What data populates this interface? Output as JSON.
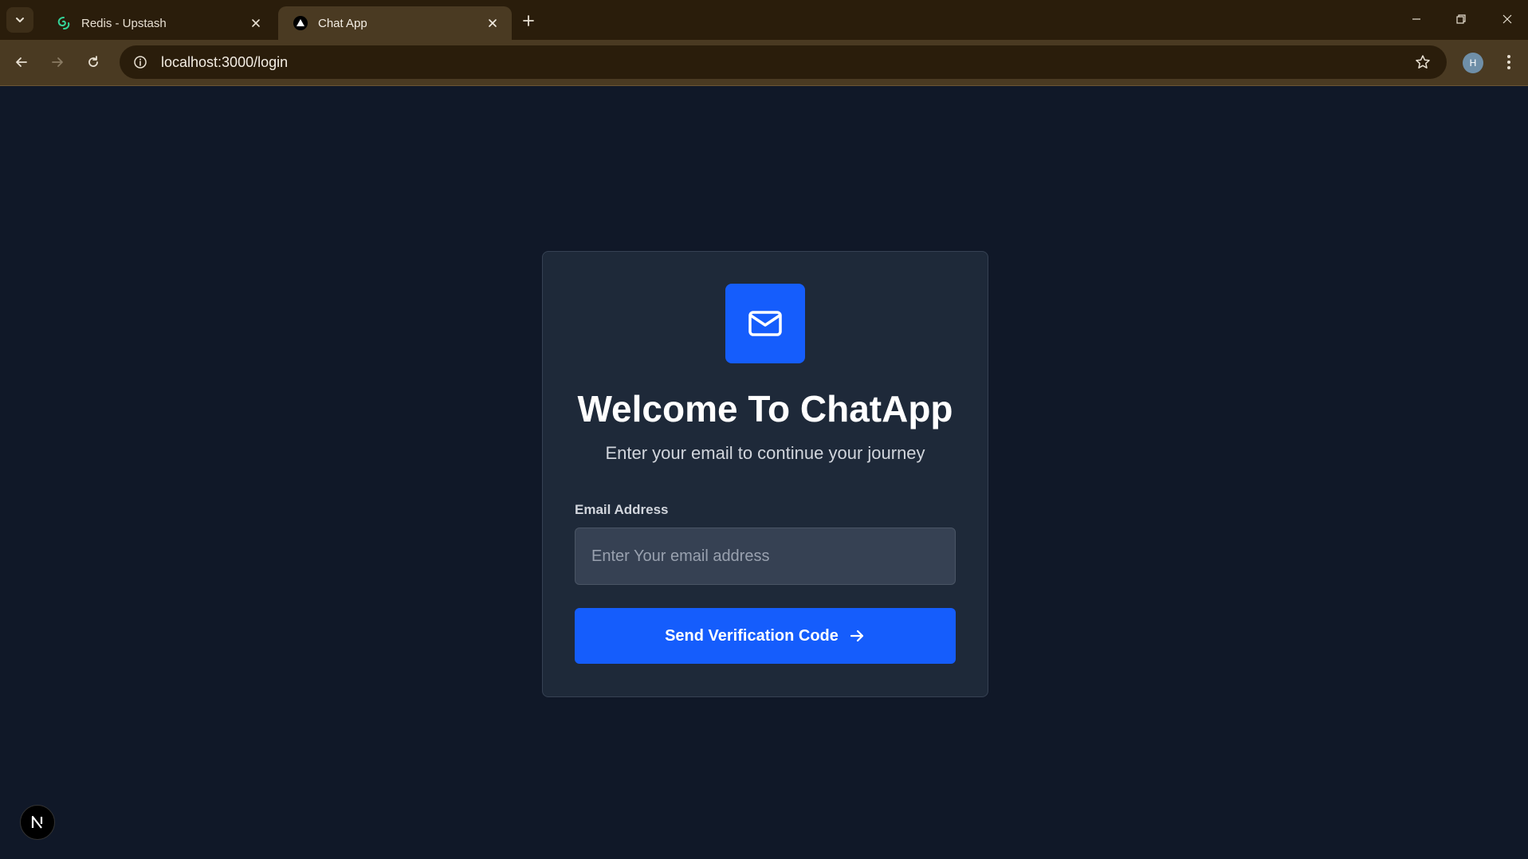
{
  "browser": {
    "tabs": [
      {
        "title": "Redis - Upstash",
        "favicon": "upstash-icon",
        "active": false
      },
      {
        "title": "Chat App",
        "favicon": "vercel-triangle-icon",
        "active": true
      }
    ],
    "url": "localhost:3000/login",
    "profile_initial": "H"
  },
  "login": {
    "icon": "mail-icon",
    "title": "Welcome To ChatApp",
    "subtitle": "Enter your email to continue your journey",
    "email_label": "Email Address",
    "email_placeholder": "Enter Your email address",
    "email_value": "",
    "submit_label": "Send Verification Code"
  },
  "colors": {
    "page_bg": "#101828",
    "card_bg": "#1e2939",
    "accent": "#155dfc",
    "input_bg": "#364153",
    "chrome_bg": "#2a1d0b",
    "chrome_toolbar": "#4a3a22"
  },
  "nextjs_badge": "N"
}
